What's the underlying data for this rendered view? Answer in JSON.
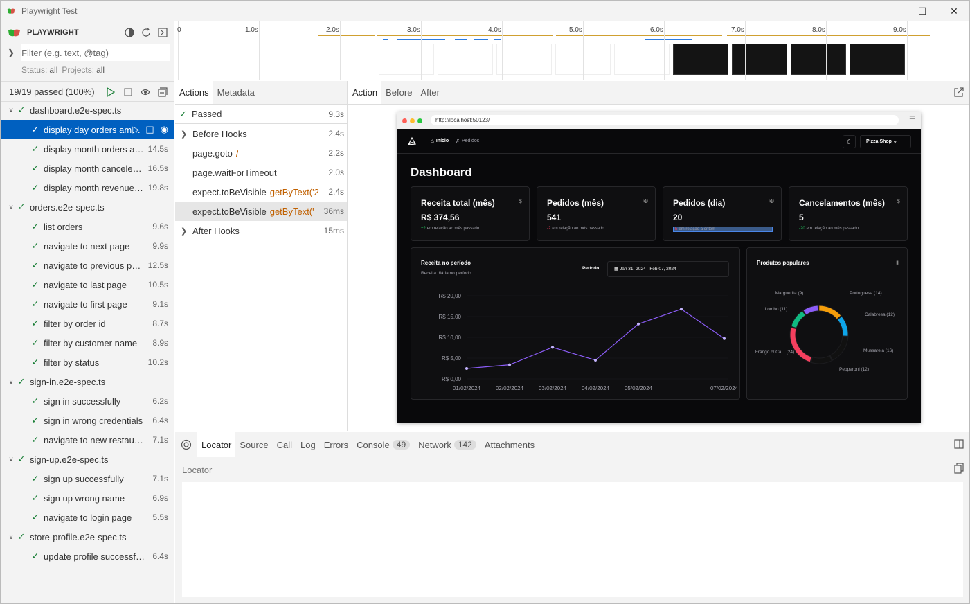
{
  "window": {
    "title": "Playwright Test"
  },
  "sidebar": {
    "brand": "PLAYWRIGHT",
    "filter_placeholder": "Filter (e.g. text, @tag)",
    "status_label": "Status:",
    "status_value": "all",
    "projects_label": "Projects:",
    "projects_value": "all",
    "summary": "19/19 passed (100%)",
    "tree": [
      {
        "kind": "file",
        "name": "dashboard.e2e-spec.ts"
      },
      {
        "kind": "test",
        "name": "display day orders amount",
        "duration": "",
        "selected": true
      },
      {
        "kind": "test",
        "name": "display month orders amount",
        "duration": "14.5s"
      },
      {
        "kind": "test",
        "name": "display month canceled orders amount",
        "duration": "16.5s"
      },
      {
        "kind": "test",
        "name": "display month revenue amount",
        "duration": "19.8s"
      },
      {
        "kind": "file",
        "name": "orders.e2e-spec.ts"
      },
      {
        "kind": "test",
        "name": "list orders",
        "duration": "9.6s"
      },
      {
        "kind": "test",
        "name": "navigate to next page",
        "duration": "9.9s"
      },
      {
        "kind": "test",
        "name": "navigate to previous page",
        "duration": "12.5s"
      },
      {
        "kind": "test",
        "name": "navigate to last page",
        "duration": "10.5s"
      },
      {
        "kind": "test",
        "name": "navigate to first page",
        "duration": "9.1s"
      },
      {
        "kind": "test",
        "name": "filter by order id",
        "duration": "8.7s"
      },
      {
        "kind": "test",
        "name": "filter by customer name",
        "duration": "8.9s"
      },
      {
        "kind": "test",
        "name": "filter by status",
        "duration": "10.2s"
      },
      {
        "kind": "file",
        "name": "sign-in.e2e-spec.ts"
      },
      {
        "kind": "test",
        "name": "sign in successfully",
        "duration": "6.2s"
      },
      {
        "kind": "test",
        "name": "sign in wrong credentials",
        "duration": "6.4s"
      },
      {
        "kind": "test",
        "name": "navigate to new restaurant page",
        "duration": "7.1s"
      },
      {
        "kind": "file",
        "name": "sign-up.e2e-spec.ts"
      },
      {
        "kind": "test",
        "name": "sign up successfully",
        "duration": "7.1s"
      },
      {
        "kind": "test",
        "name": "sign up wrong name",
        "duration": "6.9s"
      },
      {
        "kind": "test",
        "name": "navigate to login page",
        "duration": "5.5s"
      },
      {
        "kind": "file",
        "name": "store-profile.e2e-spec.ts"
      },
      {
        "kind": "test",
        "name": "update profile successfully",
        "duration": "6.4s"
      }
    ]
  },
  "timeline": {
    "labels": [
      "0",
      "1.0s",
      "2.0s",
      "3.0s",
      "4.0s",
      "5.0s",
      "6.0s",
      "7.0s",
      "8.0s",
      "9.0s"
    ]
  },
  "actions_panel": {
    "tabs": [
      "Actions",
      "Metadata"
    ],
    "status": "Passed",
    "status_duration": "9.3s",
    "items": [
      {
        "label": "Before Hooks",
        "sel": "",
        "duration": "2.4s",
        "expandable": true
      },
      {
        "label": "page.goto",
        "sel": "/",
        "duration": "2.2s"
      },
      {
        "label": "page.waitForTimeout",
        "sel": "",
        "duration": "2.0s"
      },
      {
        "label": "expect.toBeVisible",
        "sel": "getByText('2",
        "duration": "2.4s"
      },
      {
        "label": "expect.toBeVisible",
        "sel": "getByText('",
        "duration": "36ms",
        "highlighted": true
      },
      {
        "label": "After Hooks",
        "sel": "",
        "duration": "15ms",
        "expandable": true
      }
    ]
  },
  "snapshot_panel": {
    "tabs": [
      "Action",
      "Before",
      "After"
    ]
  },
  "browser": {
    "url": "http://localhost:50123/",
    "nav": {
      "home": "Início",
      "orders": "Pedidos",
      "store": "Pizza Shop"
    },
    "page_title": "Dashboard",
    "cards": [
      {
        "title": "Receita total (mês)",
        "value": "R$ 374,56",
        "diff": "+2",
        "note": "em relação ao mês passado",
        "diff_color": "#22c55e",
        "icon": "dollar-icon"
      },
      {
        "title": "Pedidos (mês)",
        "value": "541",
        "diff": "-2",
        "note": "em relação ao mês passado",
        "diff_color": "#f43f5e",
        "icon": "utensils-icon"
      },
      {
        "title": "Pedidos (dia)",
        "value": "20",
        "diff": "-5",
        "note": "em relação a ontem",
        "diff_color": "#f43f5e",
        "icon": "utensils-icon"
      },
      {
        "title": "Cancelamentos (mês)",
        "value": "5",
        "diff": "-20",
        "note": "em relação ao mês passado",
        "diff_color": "#22c55e",
        "icon": "dollar-icon"
      }
    ],
    "revenue": {
      "title": "Receita no período",
      "subtitle": "Receita diária no período",
      "period_label": "Período",
      "period_value": "Jan 31, 2024 - Feb 07, 2024"
    },
    "popular": {
      "title": "Produtos populares"
    }
  },
  "chart_data": [
    {
      "type": "line",
      "title": "Receita no período",
      "x": [
        "01/02/2024",
        "02/02/2024",
        "03/02/2024",
        "04/02/2024",
        "05/02/2024",
        "06/02/2024",
        "07/02/2024"
      ],
      "y_ticks": [
        "R$ 0,00",
        "R$ 5,00",
        "R$ 10,00",
        "R$ 15,00",
        "R$ 20,00"
      ],
      "series": [
        {
          "values": [
            2.5,
            3.4,
            7.6,
            4.5,
            13.2,
            16.8,
            9.7
          ]
        }
      ],
      "ylim": [
        0,
        20
      ],
      "color": "#8b5cf6"
    },
    {
      "type": "pie",
      "title": "Produtos populares",
      "categories": [
        "Marguerita (9)",
        "Portuguesa (14)",
        "Calabresa (12)",
        "Mussarela (16)",
        "Pepperoni (12)",
        "Frango c/ Ca... (24)",
        "Lombo (11)"
      ],
      "values": [
        9,
        14,
        12,
        16,
        12,
        24,
        11
      ],
      "colors": [
        "#8b5cf6",
        "#f59e0b",
        "#0ea5e9",
        "#111111",
        "#111111",
        "#f43f5e",
        "#10b981"
      ]
    }
  ],
  "bottom_panel": {
    "tabs": [
      "Locator",
      "Source",
      "Call",
      "Log",
      "Errors",
      "Console",
      "Network",
      "Attachments"
    ],
    "console_count": "49",
    "network_count": "142",
    "locator_label": "Locator"
  }
}
